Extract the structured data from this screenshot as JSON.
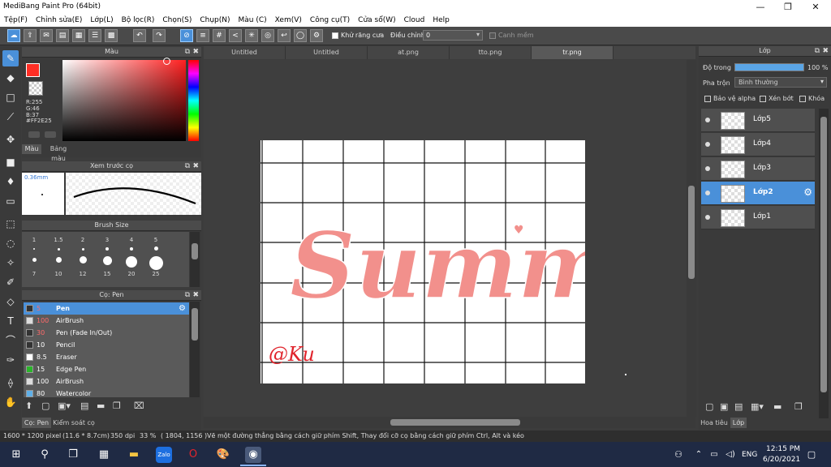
{
  "window": {
    "title": "MediBang Paint Pro (64bit)"
  },
  "menu": [
    "Tệp(F)",
    "Chỉnh sửa(E)",
    "Lớp(L)",
    "Bộ lọc(R)",
    "Chọn(S)",
    "Chụp(N)",
    "Màu (C)",
    "Xem(V)",
    "Công cụ(T)",
    "Cửa sổ(W)",
    "Cloud",
    "Help"
  ],
  "toolbar": {
    "antialias_label": "Khử răng cưa",
    "adjust_label": "Điều chỉnh",
    "adjust_value": "0",
    "edge_label": "Canh mềm"
  },
  "color_panel": {
    "title": "Màu",
    "r": "R:255",
    "g": "G:46",
    "b": "B:37",
    "hex": "#FF2E25",
    "tab_color": "Màu",
    "tab_palette": "Bảng màu",
    "fg_color": "#ff2e25"
  },
  "brush_preview": {
    "title": "Xem trước cọ",
    "size": "0.36mm"
  },
  "brush_size": {
    "title": "Brush Size",
    "sizes": [
      "1",
      "1.5",
      "2",
      "3",
      "4",
      "5",
      "7",
      "10",
      "12",
      "15",
      "20",
      "25"
    ]
  },
  "brush_panel": {
    "title": "Cọ: Pen",
    "items": [
      {
        "size": "5",
        "name": "Pen",
        "color": "#333333"
      },
      {
        "size": "100",
        "name": "AirBrush",
        "color": "#dddddd"
      },
      {
        "size": "30",
        "name": "Pen (Fade In/Out)",
        "color": "#333333"
      },
      {
        "size": "10",
        "name": "Pencil",
        "color": "#333333"
      },
      {
        "size": "8.5",
        "name": "Eraser",
        "color": "#ffffff"
      },
      {
        "size": "15",
        "name": "Edge Pen",
        "color": "#2ab52a"
      },
      {
        "size": "100",
        "name": "AirBrush",
        "color": "#dddddd"
      },
      {
        "size": "80",
        "name": "Watercolor",
        "color": "#5fb0e8"
      }
    ],
    "tab_pen": "Cọ: Pen",
    "tab_control": "Kiểm soát cọ"
  },
  "tabs": [
    {
      "label": "Untitled"
    },
    {
      "label": "Untitled"
    },
    {
      "label": "at.png"
    },
    {
      "label": "tto.png"
    },
    {
      "label": "tr.png"
    }
  ],
  "canvas": {
    "artwork_text": "Summi",
    "signature": "@Ku"
  },
  "layers_panel": {
    "title": "Lớp",
    "opacity_label": "Độ trong",
    "opacity_value": "100 %",
    "opacity": 1.0,
    "blend_label": "Pha trộn",
    "blend_value": "Bình thường",
    "protect_alpha": "Bảo vệ alpha",
    "clipping": "Xén bớt",
    "lock": "Khóa",
    "layers": [
      {
        "name": "Lớp5"
      },
      {
        "name": "Lớp4"
      },
      {
        "name": "Lớp3"
      },
      {
        "name": "Lớp2"
      },
      {
        "name": "Lớp1"
      }
    ],
    "tab_material": "Hoa tiêu",
    "tab_layer": "Lớp"
  },
  "status": {
    "size": "1600 * 1200 pixel",
    "cm": "(11.6 * 8.7cm)",
    "dpi": "350 dpi",
    "zoom": "33 %",
    "coords": "( 1804, 1156 )",
    "hint": "Vẽ một đường thẳng bằng cách giữ phím Shift, Thay đổi cỡ cọ bằng cách giữ phím Ctrl, Alt và kéo"
  },
  "taskbar": {
    "lang": "ENG",
    "time": "12:15 PM",
    "date": "6/20/2021"
  }
}
